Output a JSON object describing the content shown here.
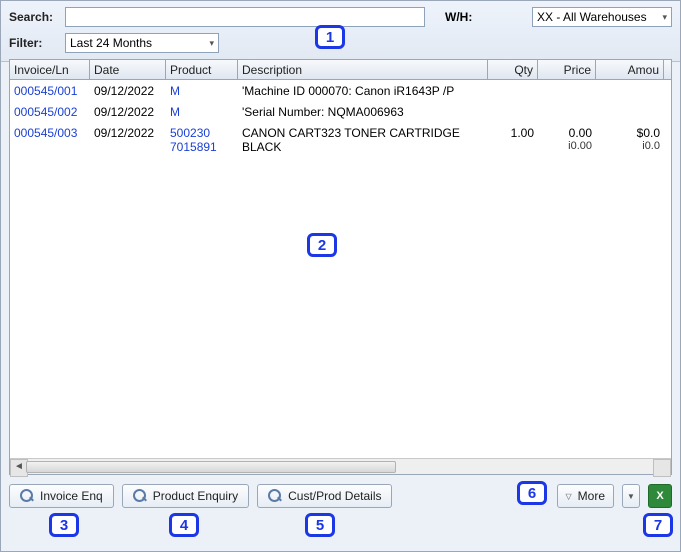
{
  "topbar": {
    "search_label": "Search:",
    "search_value": "",
    "wh_label": "W/H:",
    "wh_value": "XX - All Warehouses",
    "filter_label": "Filter:",
    "filter_value": "Last 24 Months"
  },
  "columns": {
    "invoice": "Invoice/Ln",
    "date": "Date",
    "product": "Product",
    "description": "Description",
    "qty": "Qty",
    "price": "Price",
    "amount": "Amou"
  },
  "rows": [
    {
      "invoice": "000545/001",
      "date": "09/12/2022",
      "product": "M",
      "product2": "",
      "desc": "'Machine ID 000070: Canon iR1643P /P",
      "desc2": "",
      "qty": "",
      "price": "",
      "price2": "",
      "amount": "",
      "amount2": ""
    },
    {
      "invoice": "000545/002",
      "date": "09/12/2022",
      "product": "M",
      "product2": "",
      "desc": "'Serial Number: NQMA006963",
      "desc2": "",
      "qty": "",
      "price": "",
      "price2": "",
      "amount": "",
      "amount2": ""
    },
    {
      "invoice": "000545/003",
      "date": "09/12/2022",
      "product": "500230",
      "product2": "7015891",
      "desc": "CANON CART323 TONER CARTRIDGE",
      "desc2": "BLACK",
      "qty": "1.00",
      "price": "0.00",
      "price2": "i0.00",
      "amount": "$0.0",
      "amount2": "i0.0"
    }
  ],
  "buttons": {
    "invoice_enq": "Invoice Enq",
    "product_enq": "Product Enquiry",
    "custprod": "Cust/Prod Details",
    "more": "More"
  },
  "callouts": {
    "1": "1",
    "2": "2",
    "3": "3",
    "4": "4",
    "5": "5",
    "6": "6",
    "7": "7"
  }
}
